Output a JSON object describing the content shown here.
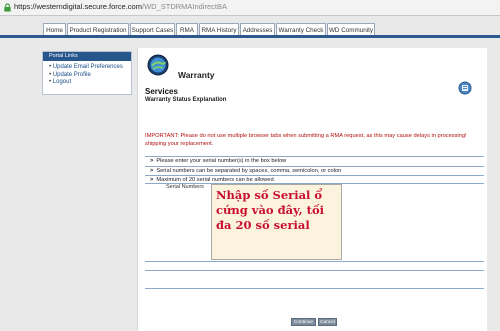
{
  "browser": {
    "url_host": "https://westerndigital.secure.force.com",
    "url_path": "/WD_STDRMAIndirectBA"
  },
  "nav": {
    "tabs": [
      "Home",
      "Product Registration",
      "Support Cases",
      "RMA",
      "RMA History",
      "Addresses",
      "Warranty Check",
      "WD Community"
    ]
  },
  "sidebar": {
    "header": "Portal Links",
    "links": [
      "Update Email Preferences",
      "Update Profile",
      "Logout"
    ]
  },
  "main": {
    "title": "Warranty",
    "section_title": "Services",
    "section_subtitle": "Warranty Status Explanation",
    "important_text": "IMPORTANT: Please do not use multiple browser tabs when submitting a RMA request, as this may cause delays in processing! shipping your replacement.",
    "instructions": [
      "Please enter your serial number(s) in the box below",
      "Serial numbers can be separated by spaces, comma, semicolon, or colon",
      "Maximum of 20 serial numbers can be allowed."
    ],
    "serial_label": "Serial Numbers",
    "serial_value": "Nhập số Serial ổ cứng vào đây, tối đa 20 số serial",
    "continue_label": "Continue",
    "cancel_label": "Cancel"
  },
  "colors": {
    "nav_bar": "#2c5a8f",
    "important_text": "#b01010",
    "overlay_text": "#c8102e",
    "serial_bg": "#fbf3de"
  }
}
